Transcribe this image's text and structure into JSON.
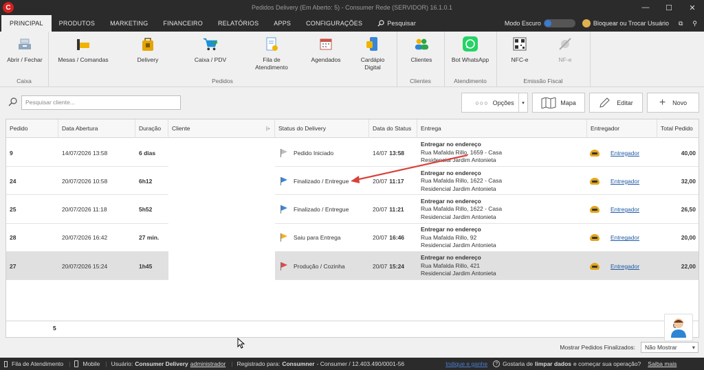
{
  "window": {
    "title": "Pedidos Delivery (Em Aberto: 5) - Consumer Rede (SERVIDOR) 16.1.0.1",
    "logo_letter": "C",
    "minimize": "—",
    "maximize": "☐",
    "close": "✕"
  },
  "menu": {
    "tabs": [
      "PRINCIPAL",
      "PRODUTOS",
      "MARKETING",
      "FINANCEIRO",
      "RELATÓRIOS",
      "APPS",
      "CONFIGURAÇÕES",
      "Pesquisar"
    ],
    "dark_mode_label": "Modo Escuro",
    "user_label": "Bloquear ou Trocar Usuário"
  },
  "ribbon": {
    "buttons": [
      {
        "label": "Abrir / Fechar",
        "icon": "cash-register-icon"
      },
      {
        "label": "Mesas / Comandas",
        "icon": "table-icon"
      },
      {
        "label": "Delivery",
        "icon": "delivery-bag-icon"
      },
      {
        "label": "Caixa / PDV",
        "icon": "cart-icon"
      },
      {
        "label": "Fila de\nAtendimento",
        "icon": "queue-document-icon"
      },
      {
        "label": "Agendados",
        "icon": "calendar-icon"
      },
      {
        "label": "Cardápio\nDigital",
        "icon": "digital-menu-icon"
      },
      {
        "label": "Clientes",
        "icon": "clients-icon"
      },
      {
        "label": "Bot WhatsApp",
        "icon": "whatsapp-icon"
      },
      {
        "label": "NFC-e",
        "icon": "qr-code-icon"
      },
      {
        "label": "NF-e",
        "icon": "satellite-icon"
      }
    ],
    "groups": [
      "Caixa",
      "Pedidos",
      "Clientes",
      "Atendimento",
      "Emissão Fiscal"
    ],
    "colors": {
      "mesas": "#f0b400",
      "delivery": "#e5a400",
      "caixa": "#1e8fd6",
      "whatsapp": "#25d366",
      "clientes": "#2c86d4"
    }
  },
  "toolbar": {
    "search_placeholder": "Pesquisar cliente...",
    "opcoes": "Opções",
    "mapa": "Mapa",
    "editar": "Editar",
    "novo": "Novo"
  },
  "table": {
    "headers": [
      "Pedido",
      "Data Abertura",
      "Duração",
      "Cliente",
      "Status do Delivery",
      "Data do Status",
      "Entrega",
      "Entregador",
      "Total Pedido"
    ],
    "rows": [
      {
        "pedido": "9",
        "abertura": "14/07/2026 13:58",
        "duracao": "6 dias",
        "status": "Pedido Iniciado",
        "flag": "#bdbdbd",
        "data_status_d": "14/07",
        "data_status_t": "13:58",
        "entrega_h": "Entregar no endereço",
        "entrega_1": "Rua Mafalda Rillo, 1659 - Casa",
        "entrega_2": "Residencial Jardim Antonieta",
        "entregador": "Entregador",
        "total": "40,00"
      },
      {
        "pedido": "24",
        "abertura": "20/07/2026 10:58",
        "duracao": "6h12",
        "status": "Finalizado / Entregue",
        "flag": "#3a86d6",
        "data_status_d": "20/07",
        "data_status_t": "11:17",
        "entrega_h": "Entregar no endereço",
        "entrega_1": "Rua Mafalda Rillo, 1622 - Casa",
        "entrega_2": "Residencial Jardim Antonieta",
        "entregador": "Entregador",
        "total": "32,00"
      },
      {
        "pedido": "25",
        "abertura": "20/07/2026 11:18",
        "duracao": "5h52",
        "status": "Finalizado / Entregue",
        "flag": "#3a86d6",
        "data_status_d": "20/07",
        "data_status_t": "11:21",
        "entrega_h": "Entregar no endereço",
        "entrega_1": "Rua Mafalda Rillo, 1622 - Casa",
        "entrega_2": "Residencial Jardim Antonieta",
        "entregador": "Entregador",
        "total": "26,50"
      },
      {
        "pedido": "28",
        "abertura": "20/07/2026 16:42",
        "duracao": "27 min.",
        "status": "Saiu para Entrega",
        "flag": "#f2b01e",
        "data_status_d": "20/07",
        "data_status_t": "16:46",
        "entrega_h": "Entregar no endereço",
        "entrega_1": "Rua Mafalda Rillo, 92",
        "entrega_2": "Residencial Jardim Antonieta",
        "entregador": "Entregador",
        "total": "20,00"
      },
      {
        "pedido": "27",
        "abertura": "20/07/2026 15:24",
        "duracao": "1h45",
        "status": "Produção / Cozinha",
        "flag": "#e04848",
        "data_status_d": "20/07",
        "data_status_t": "15:24",
        "entrega_h": "Entregar no endereço",
        "entrega_1": "Rua Mafalda Rillo, 421",
        "entrega_2": "Residencial Jardim Antonieta",
        "entregador": "Entregador",
        "total": "22,00"
      }
    ],
    "footer_count": "5"
  },
  "bottom": {
    "finalizados_label": "Mostrar Pedidos Finalizados:",
    "finalizados_value": "Não Mostrar"
  },
  "statusbar": {
    "fila": "Fila de Atendimento",
    "mobile": "Mobile",
    "usuario_label": "Usuário:",
    "usuario_name": "Consumer Delivery",
    "usuario_role": "administrador",
    "registrado_label": "Registrado para:",
    "registrado_name": "Consumner",
    "registrado_rest": "- Consumer / 12.403.490/0001-56",
    "indique": "Indique e ganhe",
    "gostaria": "Gostaria de",
    "limpar": "limpar dados",
    "comecar": "e começar sua operação?",
    "saiba": "Saiba mais"
  }
}
